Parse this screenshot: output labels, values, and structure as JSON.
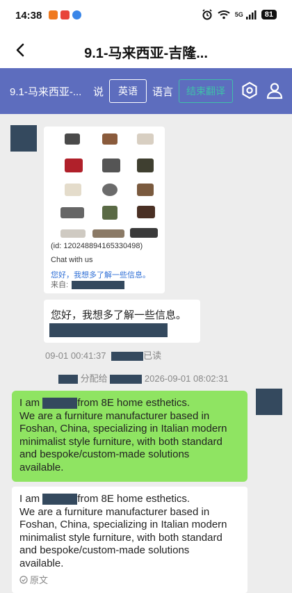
{
  "status_bar": {
    "time": "14:38",
    "battery": "81",
    "network": "5G"
  },
  "title_bar": {
    "title": "9.1-马来西亚-吉隆..."
  },
  "toolbar": {
    "chat_name": "9.1-马来西亚-...",
    "say_label": "说",
    "language_button": "英语",
    "language_label": "语言",
    "end_button": "结束翻译",
    "accent_color": "#5d6dbe",
    "end_color": "#3fc0a9"
  },
  "catalog_card": {
    "id_text": "(id: 120248894165330498)",
    "chat_with": "Chat with us",
    "greeting": "您好，我想多了解一些信息。",
    "from_label": "来自:"
  },
  "incoming_message": {
    "text": "您好，我想多了解一些信息。",
    "timestamp": "09-01 00:41:37",
    "read_status": "已读"
  },
  "assign_notice": {
    "label": "分配给",
    "datetime": "2026-09-01 08:02:31"
  },
  "outgoing_message": {
    "lines": [
      [
        "I am ",
        "from 8E home esthetics."
      ],
      "We are a furniture manufacturer based in",
      "Foshan, China, specializing in Italian modern",
      "minimalist style furniture, with both standard",
      "and bespoke/custom-made solutions",
      "available."
    ],
    "bubble_color": "#8fe462"
  },
  "translated_message": {
    "lines": [
      [
        "I am ",
        "from 8E home esthetics."
      ],
      "We are a furniture manufacturer based in",
      "Foshan, China, specializing in Italian modern",
      "minimalist style furniture, with both standard",
      "and bespoke/custom-made solutions",
      "available."
    ],
    "original_label": "原文"
  }
}
